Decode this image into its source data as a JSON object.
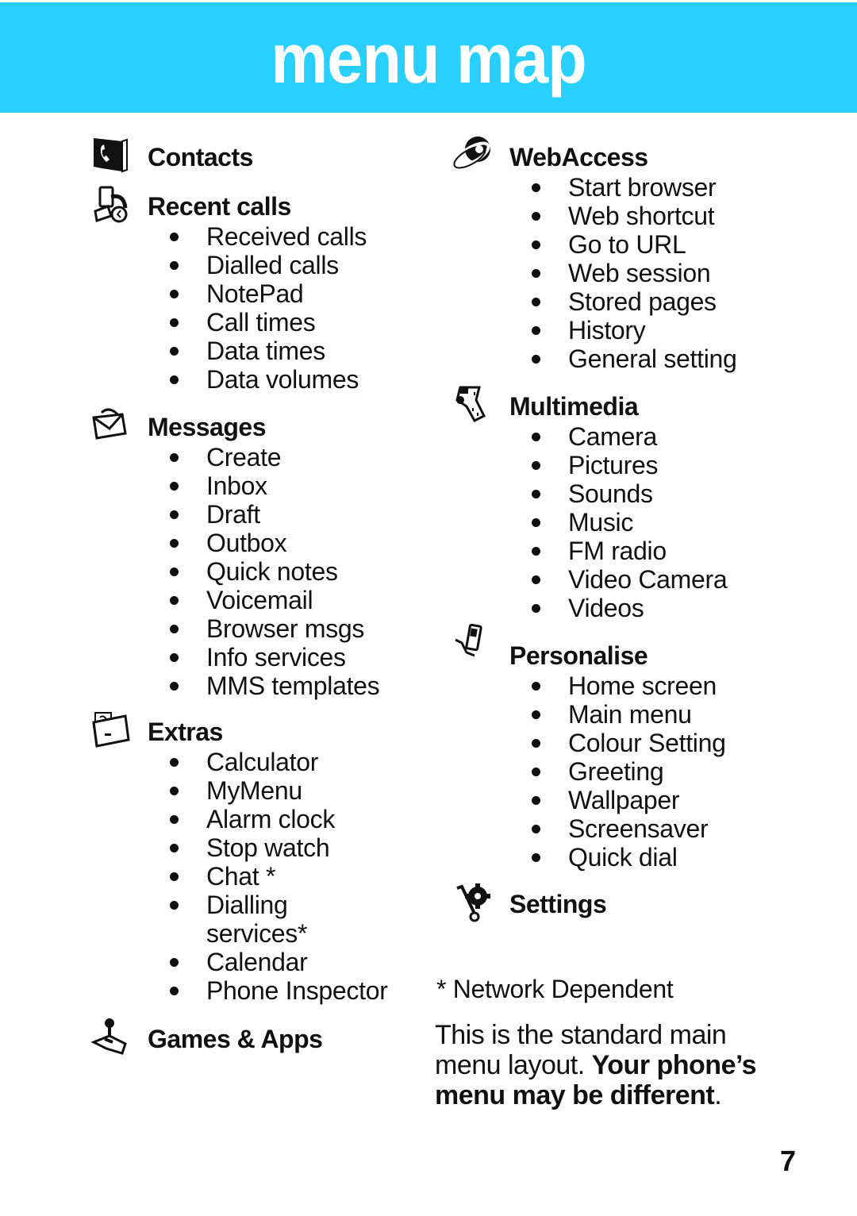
{
  "header": {
    "title": "menu map",
    "background_color": "#29cfff",
    "title_color": "#ffffff"
  },
  "left_column": [
    {
      "title": "Contacts",
      "icon": "contacts-book-icon",
      "items": []
    },
    {
      "title": "Recent calls",
      "icon": "recent-calls-icon",
      "items": [
        "Received calls",
        "Dialled calls",
        "NotePad",
        "Call times",
        "Data times",
        "Data volumes"
      ]
    },
    {
      "title": "Messages",
      "icon": "envelope-icon",
      "items": [
        "Create",
        "Inbox",
        "Draft",
        "Outbox",
        "Quick notes",
        "Voicemail",
        "Browser msgs",
        "Info services",
        "MMS templates"
      ]
    },
    {
      "title": "Extras",
      "icon": "extras-folder-icon",
      "items": [
        "Calculator",
        "MyMenu",
        "Alarm clock",
        "Stop watch",
        "Chat *",
        "Dialling services*",
        "Calendar",
        "Phone Inspector"
      ]
    },
    {
      "title": "Games & Apps",
      "icon": "joystick-icon",
      "items": []
    }
  ],
  "right_column": [
    {
      "title": "WebAccess",
      "icon": "globe-icon",
      "items": [
        "Start browser",
        "Web shortcut",
        "Go to URL",
        "Web session",
        "Stored pages",
        "History",
        "General setting"
      ]
    },
    {
      "title": "Multimedia",
      "icon": "film-strip-icon",
      "items": [
        "Camera",
        "Pictures",
        "Sounds",
        "Music",
        "FM radio",
        "Video Camera",
        "Videos"
      ]
    },
    {
      "title": "Personalise",
      "icon": "phone-hand-icon",
      "items": [
        "Home screen",
        "Main menu",
        "Colour Setting",
        "Greeting",
        "Wallpaper",
        "Screensaver",
        "Quick dial"
      ]
    },
    {
      "title": "Settings",
      "icon": "wrench-gear-icon",
      "items": []
    }
  ],
  "footnote": "* Network Dependent",
  "note": {
    "regular": "This is the standard main menu layout. ",
    "bold": "Your phone’s menu may be different",
    "end": "."
  },
  "page_number": "7"
}
